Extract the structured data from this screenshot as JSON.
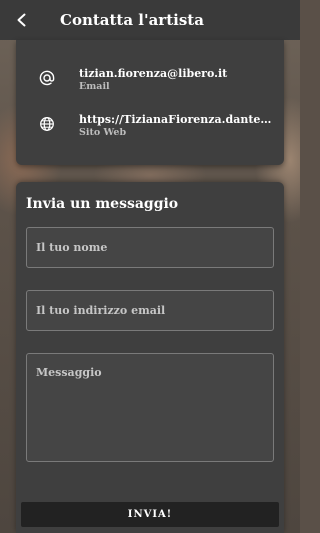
{
  "header": {
    "title": "Contatta l'artista",
    "back_icon": "chevron-left-icon"
  },
  "contact": {
    "email": {
      "icon": "at-sign-icon",
      "value": "tizian.fiorenza@libero.it",
      "label": "Email"
    },
    "website": {
      "icon": "globe-icon",
      "value": "https://TizianaFiorenza.danteb...",
      "label": "Sito Web"
    }
  },
  "form": {
    "title": "Invia un messaggio",
    "name_placeholder": "Il tuo nome",
    "email_placeholder": "Il tuo indirizzo email",
    "message_placeholder": "Messaggio",
    "submit_label": "INVIA!"
  },
  "colors": {
    "header_bg": "#3a3a3a",
    "card_bg": "#3f3f3f",
    "button_bg": "#222222"
  }
}
